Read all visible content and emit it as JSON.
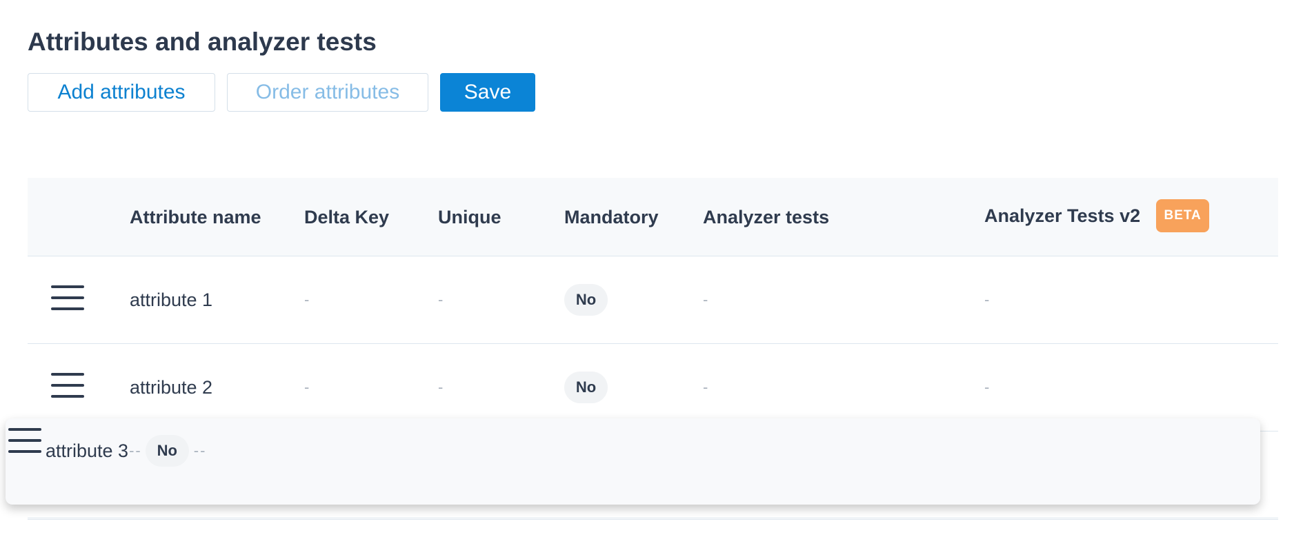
{
  "page": {
    "title": "Attributes and analyzer tests"
  },
  "toolbar": {
    "add_label": "Add attributes",
    "order_label": "Order attributes",
    "save_label": "Save"
  },
  "table": {
    "headers": {
      "name": "Attribute name",
      "delta_key": "Delta Key",
      "unique": "Unique",
      "mandatory": "Mandatory",
      "analyzer_tests": "Analyzer tests",
      "analyzer_tests_v2": "Analyzer Tests v2",
      "beta_badge": "BETA"
    },
    "rows": [
      {
        "name": "attribute 1",
        "delta_key": "-",
        "unique": "-",
        "mandatory": "No",
        "analyzer_tests": "-",
        "analyzer_tests_v2": "-"
      },
      {
        "name": "attribute 2",
        "delta_key": "-",
        "unique": "-",
        "mandatory": "No",
        "analyzer_tests": "-",
        "analyzer_tests_v2": "-"
      }
    ],
    "dragging_row": {
      "name": "attribute 3",
      "delta_key": "-",
      "unique": "-",
      "mandatory": "No",
      "analyzer_tests": "-",
      "analyzer_tests_v2": "-"
    }
  },
  "colors": {
    "primary": "#0b84d6",
    "beta": "#f8a25b",
    "text": "#2f3b4e"
  },
  "icons": {
    "drag_handle": "hamburger-icon"
  }
}
